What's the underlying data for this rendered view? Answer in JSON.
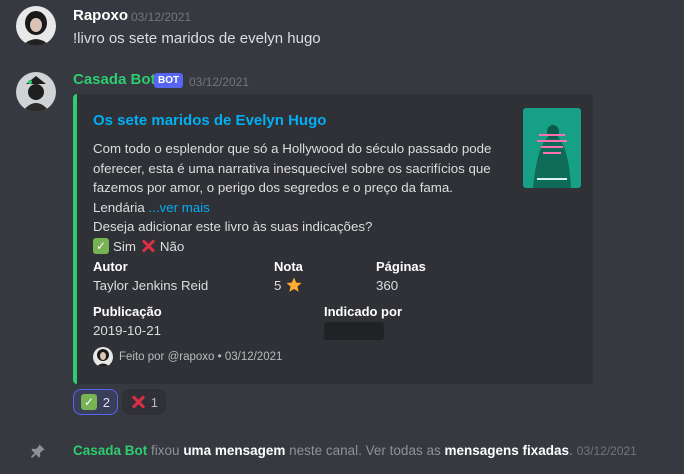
{
  "messages": [
    {
      "username": "Rapoxo",
      "username_color": "#ffffff",
      "timestamp": "03/12/2021",
      "text": "!livro os sete maridos de evelyn hugo"
    },
    {
      "username": "Casada Bot",
      "username_color": "#2ecc71",
      "bot_tag": "BOT",
      "timestamp": "03/12/2021"
    }
  ],
  "embed": {
    "accent_color": "#2ecc71",
    "title": "Os sete maridos de Evelyn Hugo",
    "description_lines": [
      "Com todo o esplendor que só a Hollywood do século passado pode",
      "oferecer, esta é uma narrativa inesquecível sobre os sacrifícios que",
      "fazemos por amor, o perigo dos segredos e o preço da fama.",
      "Lendária"
    ],
    "read_more": "...ver mais",
    "question": "Deseja adicionar este livro às suas indicações?",
    "yes_label": "Sim",
    "no_label": "Não",
    "fields": {
      "author_name": "Autor",
      "author_value": "Taylor Jenkins Reid",
      "rating_name": "Nota",
      "rating_value": "5",
      "pages_name": "Páginas",
      "pages_value": "360",
      "published_name": "Publicação",
      "published_value": "2019-10-21",
      "recommended_name": "Indicado por"
    },
    "footer_text": "Feito por @rapoxo • 03/12/2021",
    "thumbnail_icon": "book-cover"
  },
  "reactions": [
    {
      "emoji": "check-mark-emoji",
      "count": "2",
      "active": true
    },
    {
      "emoji": "cross-mark-emoji",
      "count": "1",
      "active": false
    }
  ],
  "system_message": {
    "icon": "pin-icon",
    "actor": "Casada Bot",
    "verb": " fixou ",
    "target": "uma mensagem",
    "middle": " neste canal. Ver todas as ",
    "link": "mensagens fixadas",
    "end": ".",
    "timestamp": "03/12/2021"
  }
}
